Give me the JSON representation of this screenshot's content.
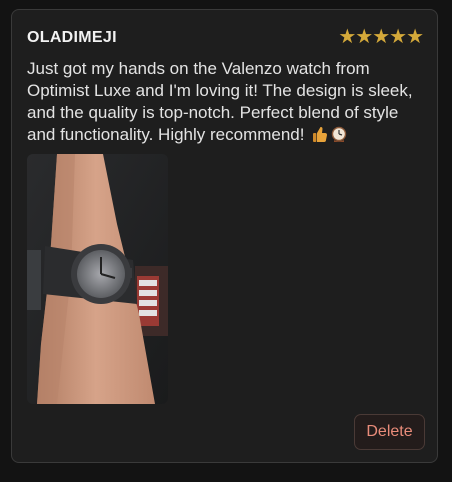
{
  "review": {
    "reviewer_name": "OLADIMEJI",
    "rating": 5,
    "rating_max": 5,
    "star_glyph": "★",
    "text": "Just got my hands on the Valenzo watch from Optimist Luxe and I'm loving it! The design is sleek, and the quality is top-notch. Perfect blend of style and functionality. Highly recommend!",
    "emojis": [
      "thumbs-up-icon",
      "watch-icon"
    ],
    "photo": "wrist-watch-photo",
    "delete_label": "Delete"
  },
  "colors": {
    "background": "#131313",
    "card": "#1e1e1e",
    "star": "#d4a93a",
    "delete_text": "#e98c7a"
  }
}
